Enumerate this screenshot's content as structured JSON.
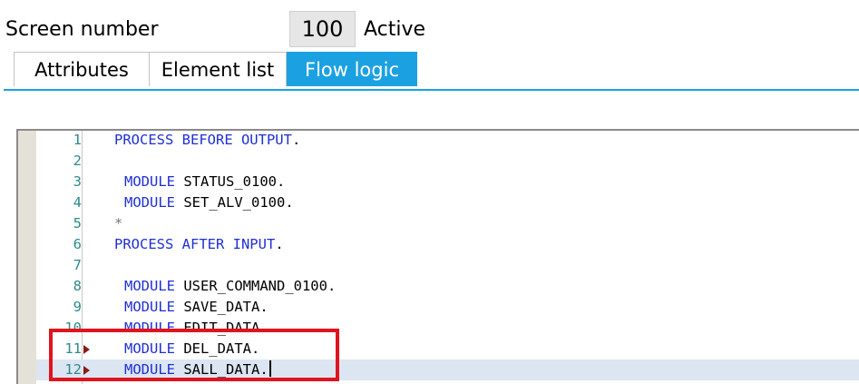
{
  "header": {
    "screen_label": "Screen number",
    "screen_number": "100",
    "status": "Active"
  },
  "tabs": [
    {
      "label": "Attributes",
      "active": false
    },
    {
      "label": "Element list",
      "active": false
    },
    {
      "label": "Flow logic",
      "active": true
    }
  ],
  "editor": {
    "current_line": 12,
    "marked_lines": [
      11,
      12
    ],
    "lines": [
      {
        "num": "1",
        "tokens": [
          {
            "t": "PROCESS BEFORE OUTPUT",
            "k": "kw"
          },
          {
            "t": ".",
            "k": "dot"
          }
        ],
        "indent": 0
      },
      {
        "num": "2",
        "tokens": [],
        "indent": 0
      },
      {
        "num": "3",
        "tokens": [
          {
            "t": "MODULE",
            "k": "kw"
          },
          {
            "t": " STATUS_0100",
            "k": "ident"
          },
          {
            "t": ".",
            "k": "dot"
          }
        ],
        "indent": 1
      },
      {
        "num": "4",
        "tokens": [
          {
            "t": "MODULE",
            "k": "kw"
          },
          {
            "t": " SET_ALV_0100",
            "k": "ident"
          },
          {
            "t": ".",
            "k": "dot"
          }
        ],
        "indent": 1
      },
      {
        "num": "5",
        "tokens": [
          {
            "t": "*",
            "k": "comment"
          }
        ],
        "indent": 0
      },
      {
        "num": "6",
        "tokens": [
          {
            "t": "PROCESS AFTER INPUT",
            "k": "kw"
          },
          {
            "t": ".",
            "k": "dot"
          }
        ],
        "indent": 0
      },
      {
        "num": "7",
        "tokens": [],
        "indent": 0
      },
      {
        "num": "8",
        "tokens": [
          {
            "t": "MODULE",
            "k": "kw"
          },
          {
            "t": " USER_COMMAND_0100",
            "k": "ident"
          },
          {
            "t": ".",
            "k": "dot"
          }
        ],
        "indent": 1
      },
      {
        "num": "9",
        "tokens": [
          {
            "t": "MODULE",
            "k": "kw"
          },
          {
            "t": " SAVE_DATA",
            "k": "ident"
          },
          {
            "t": ".",
            "k": "dot"
          }
        ],
        "indent": 1
      },
      {
        "num": "10",
        "tokens": [
          {
            "t": "MODULE",
            "k": "kw"
          },
          {
            "t": " EDIT_DATA",
            "k": "ident"
          },
          {
            "t": ".",
            "k": "dot"
          }
        ],
        "indent": 1
      },
      {
        "num": "11",
        "tokens": [
          {
            "t": "MODULE",
            "k": "kw"
          },
          {
            "t": " DEL_DATA",
            "k": "ident"
          },
          {
            "t": ".",
            "k": "dot"
          }
        ],
        "indent": 1
      },
      {
        "num": "12",
        "tokens": [
          {
            "t": "MODULE",
            "k": "kw"
          },
          {
            "t": " SALL_DATA",
            "k": "ident"
          },
          {
            "t": ".",
            "k": "dot"
          }
        ],
        "indent": 1
      }
    ]
  },
  "colors": {
    "active_tab": "#1ba1e2",
    "keyword": "#1f2fd6",
    "line_number": "#2e8b8b",
    "highlight_box": "#e0141e",
    "current_line_bg": "#dce6f2"
  }
}
